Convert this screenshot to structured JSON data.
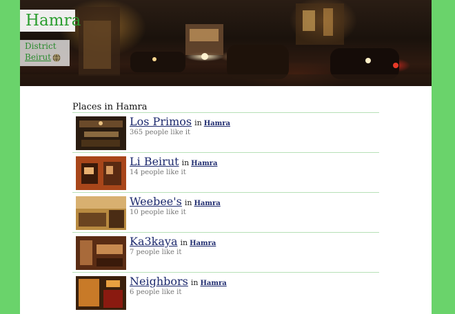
{
  "header": {
    "title": "Hamra",
    "district_label": "District",
    "district_value": "Beirut",
    "globe_icon": "globe-icon"
  },
  "section": {
    "title": "Places in Hamra"
  },
  "places": [
    {
      "name": "Los Primos",
      "in_label": "in",
      "district": "Hamra",
      "likes": "365 people like it"
    },
    {
      "name": "Li Beirut",
      "in_label": "in",
      "district": "Hamra",
      "likes": "14 people like it"
    },
    {
      "name": "Weebee's",
      "in_label": "in",
      "district": "Hamra",
      "likes": "10 people like it"
    },
    {
      "name": "Ka3kaya",
      "in_label": "in",
      "district": "Hamra",
      "likes": "7 people like it"
    },
    {
      "name": "Neighbors",
      "in_label": "in",
      "district": "Hamra",
      "likes": "6 people like it"
    }
  ],
  "colors": {
    "background": "#6ad36b",
    "title_green": "#2a9d2e",
    "link_navy": "#1d2a6e",
    "divider": "#b6e0b6"
  }
}
